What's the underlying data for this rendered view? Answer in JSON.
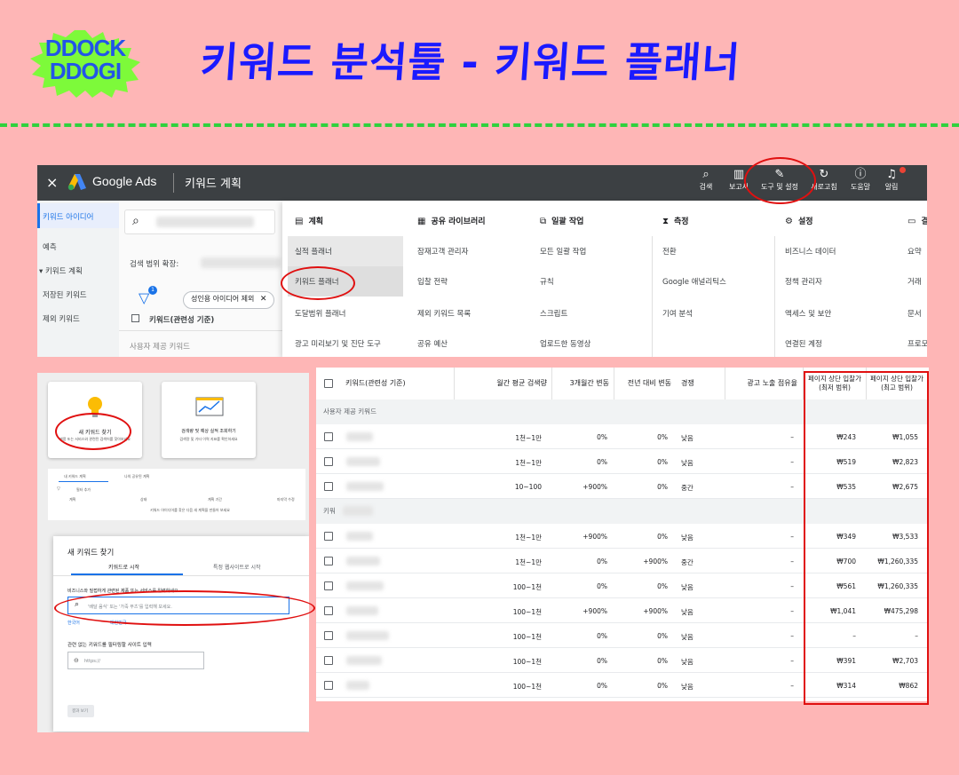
{
  "header": {
    "logo_line1": "DDOCK",
    "logo_line2": "DDOGI",
    "title": "키워드 분석툴 - 키워드 플래너"
  },
  "colors": {
    "background": "#feb6b6",
    "title": "#1a1aff",
    "dash": "#2fd13e",
    "highlight": "#e01010",
    "ads_bar": "#3c4043"
  },
  "ads": {
    "close": "×",
    "brand": "Google Ads",
    "page": "키워드 계획",
    "tools": [
      {
        "icon": "search-icon",
        "glyph": "⌕",
        "label": "검색"
      },
      {
        "icon": "report-icon",
        "glyph": "▥",
        "label": "보고서"
      },
      {
        "icon": "wrench-icon",
        "glyph": "🔧",
        "label": "도구 및 설정"
      },
      {
        "icon": "refresh-icon",
        "glyph": "↻",
        "label": "새로고침"
      },
      {
        "icon": "help-icon",
        "glyph": "?",
        "label": "도움말"
      },
      {
        "icon": "bell-icon",
        "glyph": "🔔",
        "label": "알림"
      }
    ],
    "sidebar": [
      "키워드 아이디어",
      "예측",
      "▾ 키워드 계획",
      "저장된 키워드",
      "제외 키워드"
    ],
    "mid": {
      "range_label": "검색 범위 확장:",
      "chip": "성인용 아이디어 제외",
      "filter_badge": "1",
      "col_header": "키워드(관련성 기준)",
      "row_hint": "사용자 제공 키워드"
    },
    "menu": [
      {
        "icon": "plan-icon",
        "glyph": "▤",
        "head": "계획",
        "items": [
          "실적 플래너",
          "키워드 플래너",
          "도달범위 플래너",
          "광고 미리보기 및 진단 도구"
        ]
      },
      {
        "icon": "library-icon",
        "glyph": "▦",
        "head": "공유 라이브러리",
        "items": [
          "잠재고객 관리자",
          "입찰 전략",
          "제외 키워드 목록",
          "공유 예산"
        ]
      },
      {
        "icon": "bulk-icon",
        "glyph": "⧉",
        "head": "일괄 작업",
        "items": [
          "모든 일괄 작업",
          "규칙",
          "스크립트",
          "업로드한 동영상"
        ]
      },
      {
        "icon": "hourglass-icon",
        "glyph": "⧗",
        "head": "측정",
        "items": [
          "전환",
          "Google 애널리틱스",
          "기여 분석"
        ]
      },
      {
        "icon": "settings-icon",
        "glyph": "⚙",
        "head": "설정",
        "items": [
          "비즈니스 데이터",
          "정책 관리자",
          "액세스 및 보안",
          "연결된 계정"
        ]
      },
      {
        "icon": "billing-icon",
        "glyph": "▭",
        "head": "결",
        "items": [
          "요약",
          "거래",
          "문서",
          "프로모"
        ]
      }
    ]
  },
  "left": {
    "card1_title": "새 키워드 찾기",
    "card1_desc": "제품 또는 서비스와 관련된 검색어를 찾아보세요",
    "card2_title": "검색량 및 예상 실적 조회하기",
    "card2_desc": "검색량 및 기타 이력 지표를 확인하세요",
    "tab_a": "내 키워드 계획",
    "tab_b": "나의 공유된 계획",
    "filter": "필터 추가",
    "cols": [
      "계획",
      "상태",
      "계획 기간",
      "마지막 수정"
    ],
    "empty_msg": "키워드 아이디어를 찾은 다음 새 계획을 만들어 보세요",
    "dialog_title": "새 키워드 찾기",
    "dialog_tab1": "키워드로 시작",
    "dialog_tab2": "특정 웹사이트로 시작",
    "dialog_prompt": "비즈니스와 밀접하게 관련된 제품 또는 서비스를 입력하세요",
    "search_placeholder": "'배달 음식' 또는 '가죽 부츠'를 입력해 보세요.",
    "lang": "한국어",
    "region": "대한민국",
    "site_label": "관련 없는 키워드를 필터링할 사이트 입력",
    "site_placeholder": "https://",
    "submit": "결과 보기"
  },
  "table": {
    "headers": {
      "keyword": "키워드(관련성 기준)",
      "volume": "월간 평균 검색량",
      "change3m": "3개월간 변동",
      "yoy": "전년 대비 변동",
      "competition": "경쟁",
      "impression": "광고 노출 점유율",
      "bid_low": "페이지 상단 입찰가(최저 범위)",
      "bid_high": "페이지 상단 입찰가(최고 범위)"
    },
    "group1": "사용자 제공 키워드",
    "group2": "키워",
    "rows1": [
      {
        "volume": "1천~1만",
        "change3m": "0%",
        "yoy": "0%",
        "competition": "낮음",
        "impression": "–",
        "bid_low": "₩243",
        "bid_high": "₩1,055"
      },
      {
        "volume": "1천~1만",
        "change3m": "0%",
        "yoy": "0%",
        "competition": "낮음",
        "impression": "–",
        "bid_low": "₩519",
        "bid_high": "₩2,823"
      },
      {
        "volume": "10~100",
        "change3m": "+900%",
        "yoy": "0%",
        "competition": "중간",
        "impression": "–",
        "bid_low": "₩535",
        "bid_high": "₩2,675"
      }
    ],
    "rows2": [
      {
        "volume": "1천~1만",
        "change3m": "+900%",
        "yoy": "0%",
        "competition": "낮음",
        "impression": "–",
        "bid_low": "₩349",
        "bid_high": "₩3,533"
      },
      {
        "volume": "1천~1만",
        "change3m": "0%",
        "yoy": "+900%",
        "competition": "중간",
        "impression": "–",
        "bid_low": "₩700",
        "bid_high": "₩1,260,335"
      },
      {
        "volume": "100~1천",
        "change3m": "0%",
        "yoy": "0%",
        "competition": "낮음",
        "impression": "–",
        "bid_low": "₩561",
        "bid_high": "₩1,260,335"
      },
      {
        "volume": "100~1천",
        "change3m": "+900%",
        "yoy": "+900%",
        "competition": "낮음",
        "impression": "–",
        "bid_low": "₩1,041",
        "bid_high": "₩475,298"
      },
      {
        "volume": "100~1천",
        "change3m": "0%",
        "yoy": "0%",
        "competition": "낮음",
        "impression": "–",
        "bid_low": "–",
        "bid_high": "–"
      },
      {
        "volume": "100~1천",
        "change3m": "0%",
        "yoy": "0%",
        "competition": "낮음",
        "impression": "–",
        "bid_low": "₩391",
        "bid_high": "₩2,703"
      },
      {
        "volume": "100~1천",
        "change3m": "0%",
        "yoy": "0%",
        "competition": "낮음",
        "impression": "–",
        "bid_low": "₩314",
        "bid_high": "₩862"
      }
    ]
  }
}
